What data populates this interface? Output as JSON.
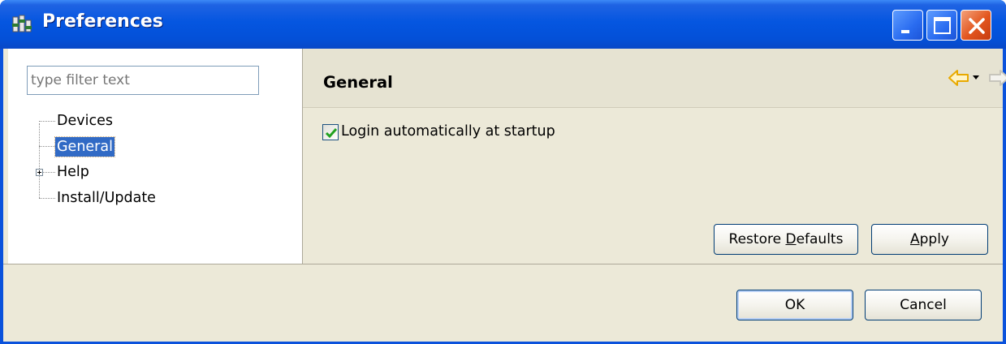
{
  "window": {
    "title": "Preferences"
  },
  "left_pane": {
    "filter_placeholder": "type filter text",
    "tree": [
      {
        "label": "Devices",
        "selected": false,
        "expandable": false
      },
      {
        "label": "General",
        "selected": true,
        "expandable": false
      },
      {
        "label": "Help",
        "selected": false,
        "expandable": true
      },
      {
        "label": "Install/Update",
        "selected": false,
        "expandable": false
      }
    ]
  },
  "page": {
    "title": "General",
    "login_checkbox": {
      "label": "Login automatically at startup",
      "checked": true
    },
    "restore_defaults": {
      "pre": "Restore ",
      "mnemonic": "D",
      "post": "efaults"
    },
    "apply": {
      "mnemonic": "A",
      "post": "pply"
    }
  },
  "dialog_buttons": {
    "ok": "OK",
    "cancel": "Cancel"
  },
  "colors": {
    "titlebar": "#0556e0",
    "selection": "#316ac5",
    "client": "#ece9d8",
    "nav_arrow_active": "#e8a900",
    "nav_arrow_disabled": "#c7c5bb"
  }
}
